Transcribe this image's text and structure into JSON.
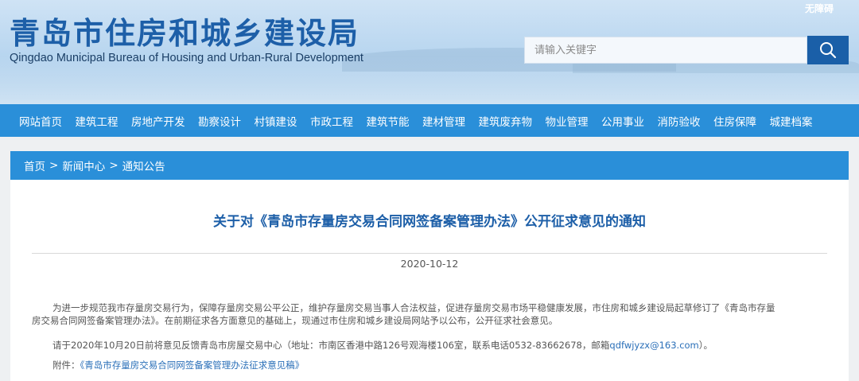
{
  "header": {
    "title": "青岛市住房和城乡建设局",
    "subtitle": "Qingdao Municipal Bureau of Housing and Urban-Rural Development",
    "barrier_free": "无障碍"
  },
  "search": {
    "placeholder": "请输入关键字",
    "icon": "search-icon"
  },
  "nav": {
    "items": [
      "网站首页",
      "建筑工程",
      "房地产开发",
      "勘察设计",
      "村镇建设",
      "市政工程",
      "建筑节能",
      "建材管理",
      "建筑废弃物",
      "物业管理",
      "公用事业",
      "消防验收",
      "住房保障",
      "城建档案"
    ]
  },
  "breadcrumb": {
    "items": [
      "首页",
      "新闻中心",
      "通知公告"
    ],
    "separator": ">"
  },
  "article": {
    "title": "关于对《青岛市存量房交易合同网签备案管理办法》公开征求意见的通知",
    "date": "2020-10-12",
    "para1_line1": "为进一步规范我市存量房交易行为，保障存量房交易公平公正，维护存量房交易当事人合法权益，促进存量房交易市场平稳健康发展，市住房和城乡建设局起草修订了《青岛市存量",
    "para1_line2": "房交易合同网签备案管理办法》。在前期征求各方面意见的基础上，现通过市住房和城乡建设局网站予以公布，公开征求社会意见。",
    "para2_text": "请于2020年10月20日前将意见反馈青岛市房屋交易中心（地址：市南区香港中路126号观海楼106室，联系电话0532-83662678，邮箱",
    "para2_email": "qdfwjyzx@163.com",
    "para2_end": "）。",
    "attachment_label": "附件：",
    "attachment_link": "《青岛市存量房交易合同网签备案管理办法征求意见稿》"
  },
  "colors": {
    "nav_bg": "#2a8fd9",
    "title_blue": "#1d5fa8",
    "search_btn": "#1a5fa8"
  }
}
